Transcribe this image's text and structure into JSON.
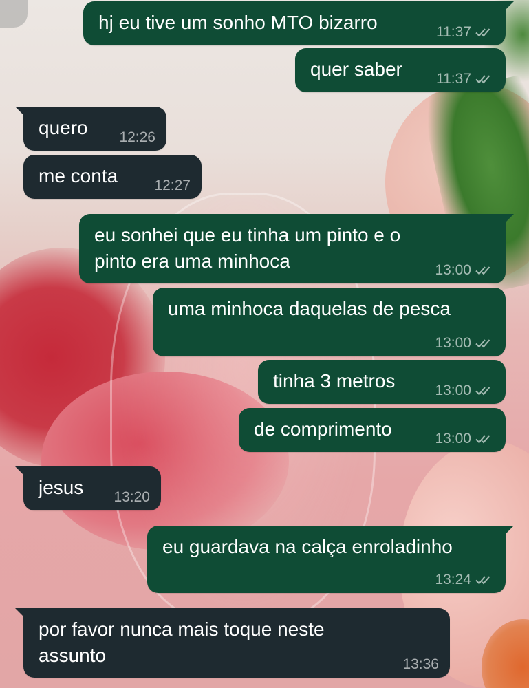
{
  "colors": {
    "outgoing_bubble": "#0f4c35",
    "incoming_bubble": "#1e2a30",
    "text": "#ffffff",
    "meta_text": "#a9b8b2"
  },
  "messages": [
    {
      "direction": "out",
      "text": "hj eu tive um sonho MTO bizarro",
      "time": "11:37",
      "status": "read-double-check-icon"
    },
    {
      "direction": "out",
      "text": "quer saber",
      "time": "11:37",
      "status": "read-double-check-icon"
    },
    {
      "direction": "in",
      "text": "quero",
      "time": "12:26"
    },
    {
      "direction": "in",
      "text": "me conta",
      "time": "12:27"
    },
    {
      "direction": "out",
      "text": "eu sonhei que eu tinha um pinto e o\npinto era uma minhoca",
      "time": "13:00",
      "status": "read-double-check-icon"
    },
    {
      "direction": "out",
      "text": "uma minhoca daquelas de pesca",
      "time": "13:00",
      "status": "read-double-check-icon"
    },
    {
      "direction": "out",
      "text": "tinha 3 metros",
      "time": "13:00",
      "status": "read-double-check-icon"
    },
    {
      "direction": "out",
      "text": "de comprimento",
      "time": "13:00",
      "status": "read-double-check-icon"
    },
    {
      "direction": "in",
      "text": "jesus",
      "time": "13:20"
    },
    {
      "direction": "out",
      "text": "eu guardava na calça enroladinho",
      "time": "13:24",
      "status": "read-double-check-icon"
    },
    {
      "direction": "in",
      "text": "por favor nunca mais toque neste\nassunto",
      "time": "13:36"
    }
  ]
}
